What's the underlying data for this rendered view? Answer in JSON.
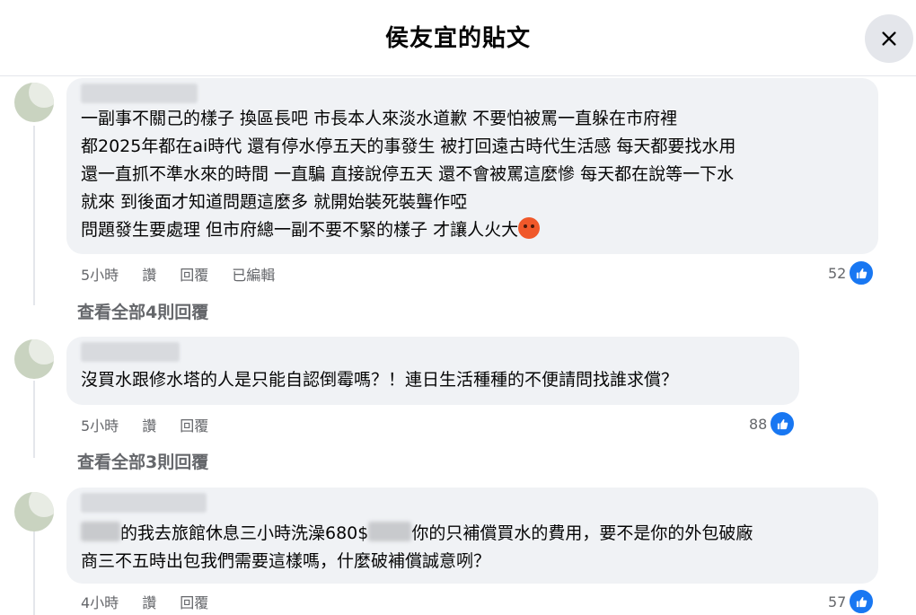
{
  "header": {
    "title": "侯友宜的貼文",
    "close_icon": "close-icon"
  },
  "comments": [
    {
      "lines": [
        "一副事不關己的樣子 換區長吧 市長本人來淡水道歉 不要怕被罵一直躲在市府裡",
        "都2025年都在ai時代 還有停水停五天的事發生 被打回遠古時代生活感 每天都要找水用",
        "還一直抓不準水來的時間 一直騙 直接說停五天 還不會被罵這麼慘 每天都在說等一下水",
        "就來 到後面才知道問題這麼多 就開始裝死裝聾作啞",
        "問題發生要處理 但市府總一副不要不緊的樣子 才讓人火大"
      ],
      "time": "5小時",
      "like_label": "讚",
      "reply_label": "回覆",
      "edited_label": "已編輯",
      "likes": "52",
      "view_replies": "查看全部4則回覆"
    },
    {
      "lines": [
        "沒買水跟修水塔的人是只能自認倒霉嗎？！連日生活種種的不便請問找誰求償？"
      ],
      "time": "5小時",
      "like_label": "讚",
      "reply_label": "回覆",
      "likes": "88",
      "view_replies": "查看全部3則回覆"
    },
    {
      "line1_a": "的我去旅館休息三小時洗澡680$",
      "line1_b": "你的只補償買水的費用，要不是你的外包破廠",
      "line2": "商三不五時出包我們需要這樣嗎，什麼破補償誠意咧？",
      "time": "4小時",
      "like_label": "讚",
      "reply_label": "回覆",
      "likes": "57"
    }
  ],
  "colors": {
    "accent": "#1877f2",
    "bubble": "#f0f2f5",
    "muted": "#65676b"
  }
}
